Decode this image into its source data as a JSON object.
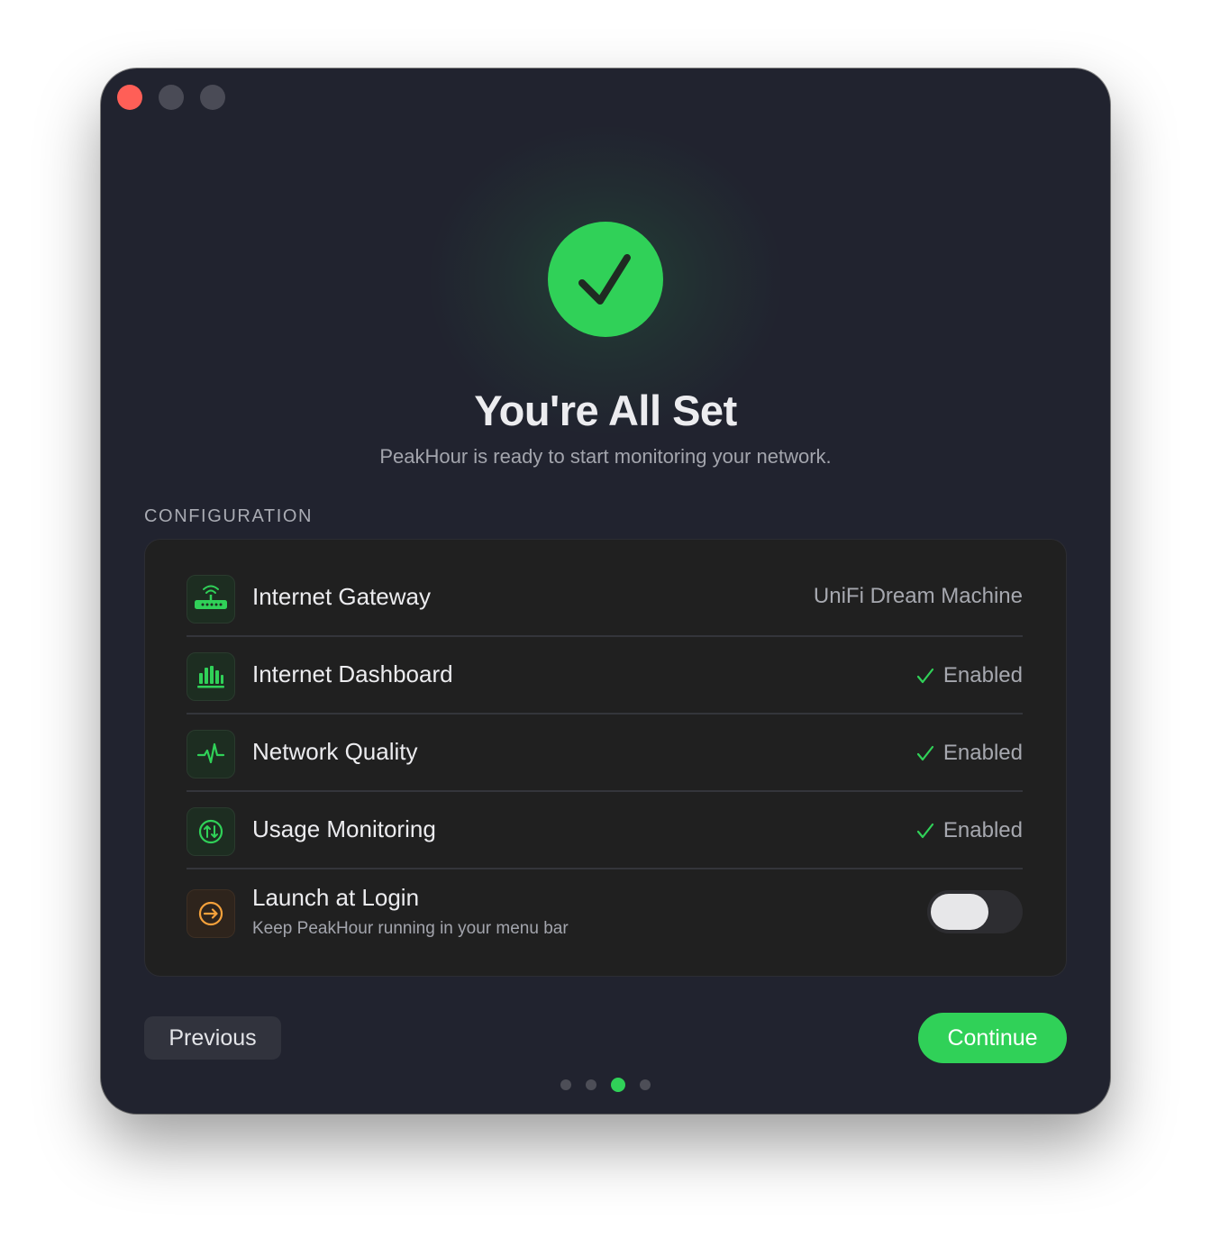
{
  "window": {
    "controls": [
      "close",
      "minimize",
      "maximize"
    ]
  },
  "hero": {
    "icon": "checkmark-circle-icon",
    "title": "You're All Set",
    "subtitle": "PeakHour is ready to start monitoring your network."
  },
  "configuration": {
    "section_label": "CONFIGURATION",
    "rows": [
      {
        "icon": "router-icon",
        "label": "Internet Gateway",
        "value": "UniFi Dream Machine"
      },
      {
        "icon": "bar-chart-icon",
        "label": "Internet Dashboard",
        "status": "Enabled"
      },
      {
        "icon": "pulse-icon",
        "label": "Network Quality",
        "status": "Enabled"
      },
      {
        "icon": "up-down-arrows-icon",
        "label": "Usage Monitoring",
        "status": "Enabled"
      }
    ],
    "launch": {
      "icon": "arrow-circle-icon",
      "label": "Launch at Login",
      "sublabel": "Keep PeakHour running in your menu bar",
      "toggle_on": false
    }
  },
  "footer": {
    "previous_label": "Previous",
    "continue_label": "Continue",
    "pages_total": 4,
    "current_page": 3
  },
  "colors": {
    "accent": "#30d158",
    "window_bg": "#21232f",
    "card_bg": "#202020",
    "launch_icon": "#f5a13b",
    "close": "#ff5f57"
  }
}
